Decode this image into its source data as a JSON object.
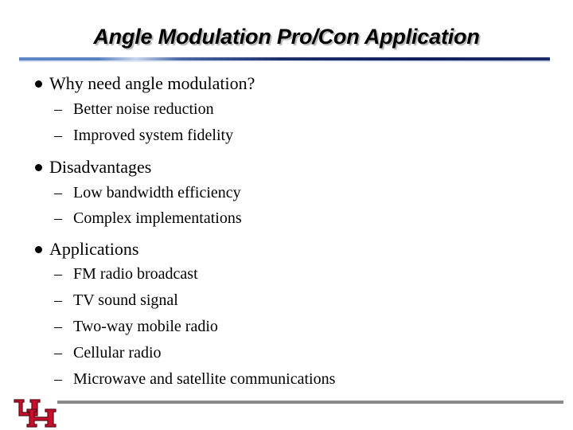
{
  "slide": {
    "title": "Angle Modulation Pro/Con Application",
    "sections": [
      {
        "heading": "Why need angle modulation?",
        "items": [
          "Better noise reduction",
          "Improved system fidelity"
        ]
      },
      {
        "heading": "Disadvantages",
        "items": [
          "Low bandwidth efficiency",
          "Complex implementations"
        ]
      },
      {
        "heading": "Applications",
        "items": [
          "FM radio broadcast",
          "TV sound signal",
          "Two-way mobile radio",
          "Cellular radio",
          "Microwave and satellite communications"
        ]
      }
    ],
    "bullet_marker": "•",
    "sub_marker": "–"
  },
  "logo": {
    "text": "UH",
    "icon": "university-of-houston-logo-icon",
    "colors": {
      "fill": "#c8102e",
      "outline": "#5a0a12"
    }
  },
  "colors": {
    "title_rule_start": "#5f86c4",
    "title_rule_end": "#10205c",
    "footer_rule": "#8a8a8a"
  }
}
